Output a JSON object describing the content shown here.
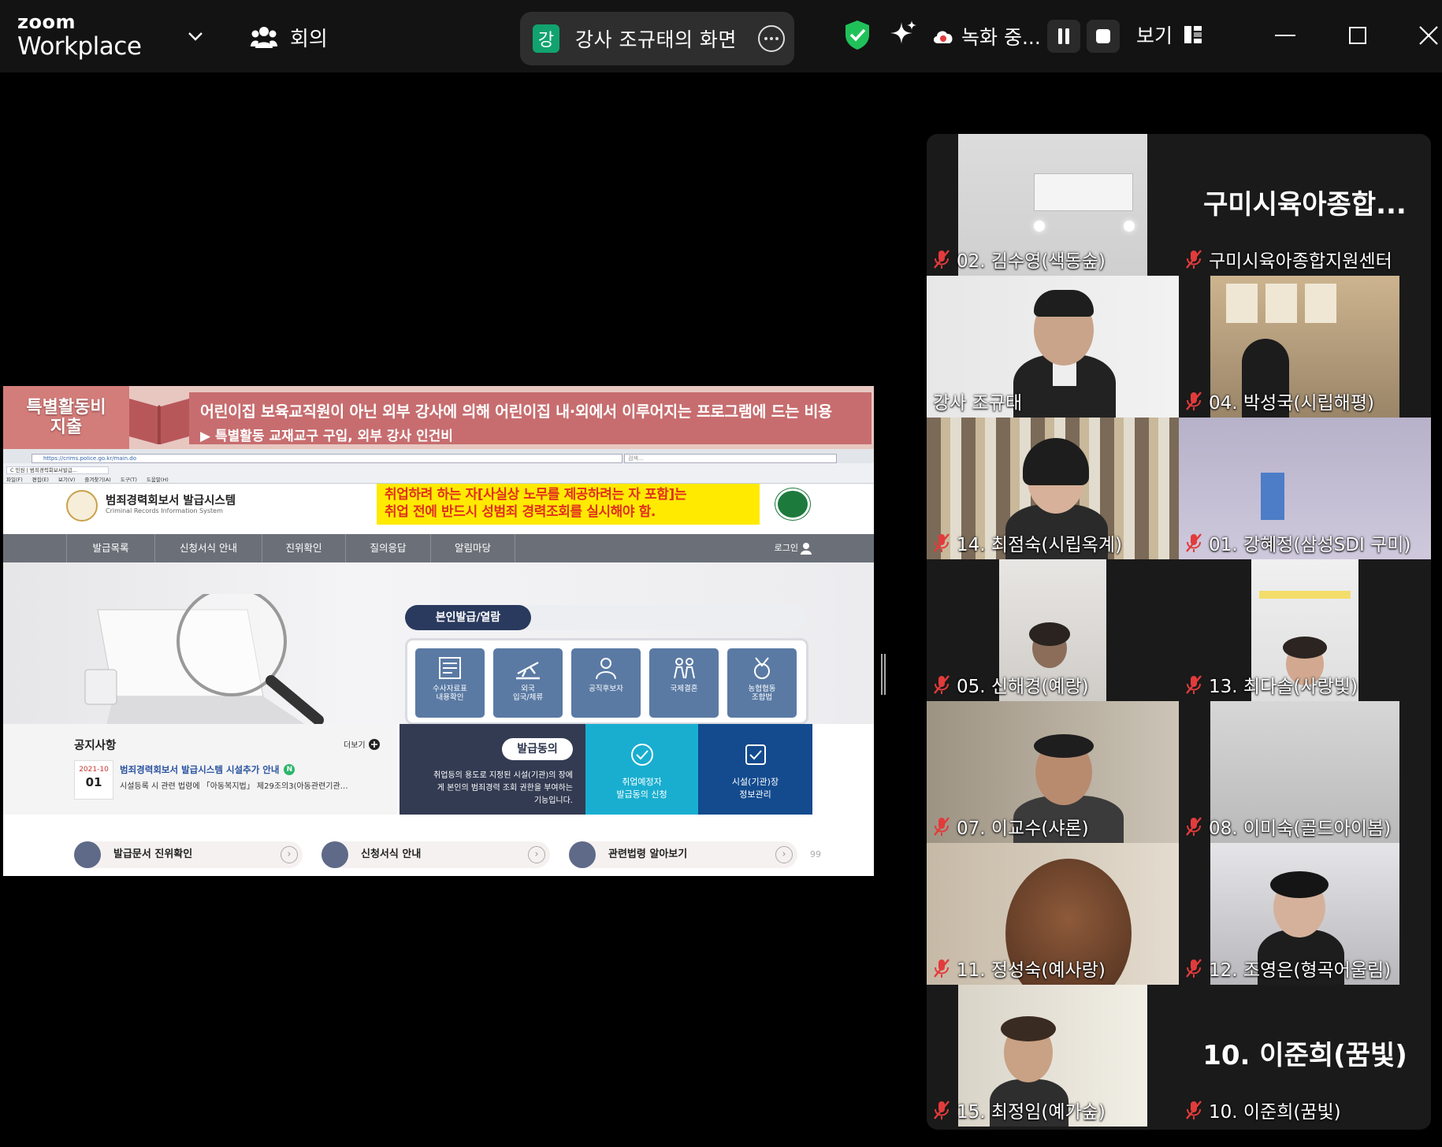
{
  "app": {
    "logo_top": "zoom",
    "logo_bottom": "Workplace"
  },
  "topbar": {
    "meeting_label": "회의",
    "share": {
      "avatar_initial": "강",
      "label": "강사 조규태의 화면"
    },
    "recording_label": "녹화 중...",
    "view_label": "보기"
  },
  "slide": {
    "tag_line1": "특별활동비",
    "tag_line2": "지출",
    "line1": "어린이집 보육교직원이 아닌 외부 강사에 의해 어린이집 내·외에서 이루어지는 프로그램에 드는 비용",
    "line2": "▶ 특별활동 교재교구 구입, 외부 강사 인건비"
  },
  "browser": {
    "url": "https://crims.police.go.kr/main.do",
    "search_placeholder": "검색...",
    "tab_title": "C 민원 | 범죄경력회보서발급...",
    "menu": [
      "파일(F)",
      "편집(E)",
      "보기(V)",
      "즐겨찾기(A)",
      "도구(T)",
      "도움말(H)"
    ]
  },
  "site": {
    "title": "범죄경력회보서 발급시스템",
    "subtitle": "Criminal Records Information System",
    "notice_line1": "취업하려 하는 자[사실상 노무를 제공하려는 자 포함]는",
    "notice_line2": "취업 전에 반드시 성범죄 경력조회를 실시해야 함.",
    "nav": [
      "발급목록",
      "신청서식 안내",
      "진위확인",
      "질의응답",
      "알림마당"
    ],
    "login_label": "로그인",
    "issue_label": "본인발급/열람",
    "services": [
      {
        "line1": "수사자료표",
        "line2": "내용확인"
      },
      {
        "line1": "외국",
        "line2": "입국/체류"
      },
      {
        "line1": "공직후보자",
        "line2": ""
      },
      {
        "line1": "국제결혼",
        "line2": ""
      },
      {
        "line1": "농협협동",
        "line2": "조합법"
      }
    ],
    "notice": {
      "title": "공지사항",
      "more_label": "더보기",
      "date_ym": "2021-10",
      "date_d": "01",
      "item": "범죄경력회보서 발급시스템 시설추가 안내",
      "new_badge": "N",
      "desc": "시설등록 시 관련 법령에 「아동복지법」 제29조의3(아동관련기관…"
    },
    "consent": {
      "label": "발급동의",
      "desc_line1": "취업등의 용도로 지정된 시설(기관)의 장에",
      "desc_line2": "게 본인의 범죄경력 조회 권한을 부여하는",
      "desc_line3": "기능입니다."
    },
    "apply": {
      "line1": "취업예정자",
      "line2": "발급동의 신청"
    },
    "mgmt": {
      "line1": "시설(기관)장",
      "line2": "정보관리"
    },
    "quick": [
      "발급문서 진위확인",
      "신청서식 안내",
      "관련법령 알아보기"
    ],
    "page_number": "99"
  },
  "participants": [
    {
      "name": "02. 김수영(색동숲)",
      "video": true
    },
    {
      "name": "구미시육아종합지원센터",
      "video": false,
      "big_name": "구미시육아종합..."
    },
    {
      "name": "강사 조규태",
      "video": true,
      "active_speaker": true
    },
    {
      "name": "04. 박성국(시립해평)",
      "video": true
    },
    {
      "name": "14. 최점숙(시립옥계)",
      "video": true
    },
    {
      "name": "01. 강혜정(삼성SDI 구미)",
      "video": true
    },
    {
      "name": "05. 신해경(예랑)",
      "video": true
    },
    {
      "name": "13. 최다솔(사랑빛)",
      "video": true
    },
    {
      "name": "07. 이교수(샤론)",
      "video": true
    },
    {
      "name": "08. 이미숙(골드아이봄)",
      "video": true
    },
    {
      "name": "11. 정성숙(예사랑)",
      "video": true
    },
    {
      "name": "12. 조영은(형곡어울림)",
      "video": true
    },
    {
      "name": "15. 최정임(예가숲)",
      "video": true
    },
    {
      "name": "10. 이준희(꿈빛)",
      "video": false,
      "big_name": "10. 이준희(꿈빛)"
    }
  ],
  "colors": {
    "active_speaker_border": "#2ed47a",
    "muted_mic": "#e23b3b",
    "share_avatar": "#11a36f",
    "shield": "#21c15a"
  }
}
